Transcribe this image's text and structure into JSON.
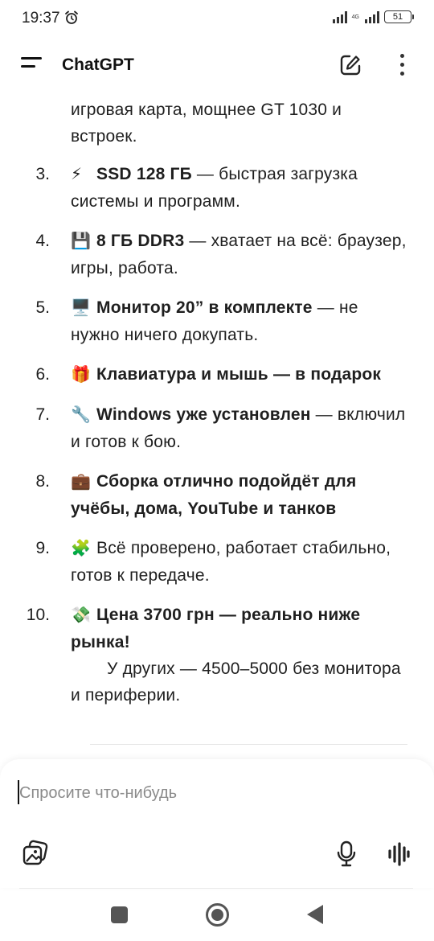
{
  "status": {
    "time": "19:37",
    "network": "4G",
    "battery": "51"
  },
  "header": {
    "title": "ChatGPT"
  },
  "content": {
    "continuation": "игровая карта, мощнее GT 1030 и встроек.",
    "items": [
      {
        "num": "3.",
        "emoji": "⚡",
        "bold": "SSD 128 ГБ",
        "text": " — быстрая загрузка системы и программ."
      },
      {
        "num": "4.",
        "emoji": "💾",
        "bold": "8 ГБ DDR3",
        "text": " — хватает на всё: браузер, игры, работа."
      },
      {
        "num": "5.",
        "emoji": "🖥️",
        "bold": "Монитор 20” в комплекте",
        "text": " — не нужно ничего докупать."
      },
      {
        "num": "6.",
        "emoji": "🎁",
        "bold": "Клавиатура и мышь — в подарок",
        "text": ""
      },
      {
        "num": "7.",
        "emoji": "🔧",
        "bold": "Windows уже установлен",
        "text": " — включил и готов к бою."
      },
      {
        "num": "8.",
        "emoji": "💼",
        "bold": "Сборка отлично подойдёт для учёбы, дома, YouTube и танков",
        "text": ""
      },
      {
        "num": "9.",
        "emoji": "🧩",
        "bold": "",
        "text": "Всё проверено, работает стабильно, готов к передаче."
      },
      {
        "num": "10.",
        "emoji": "💸",
        "bold": "Цена 3700 грн — реально ниже рынка!",
        "text": "",
        "extra": "У других — 4500–5000 без монитора и периферии."
      }
    ]
  },
  "composer": {
    "placeholder": "Спросите что-нибудь"
  }
}
